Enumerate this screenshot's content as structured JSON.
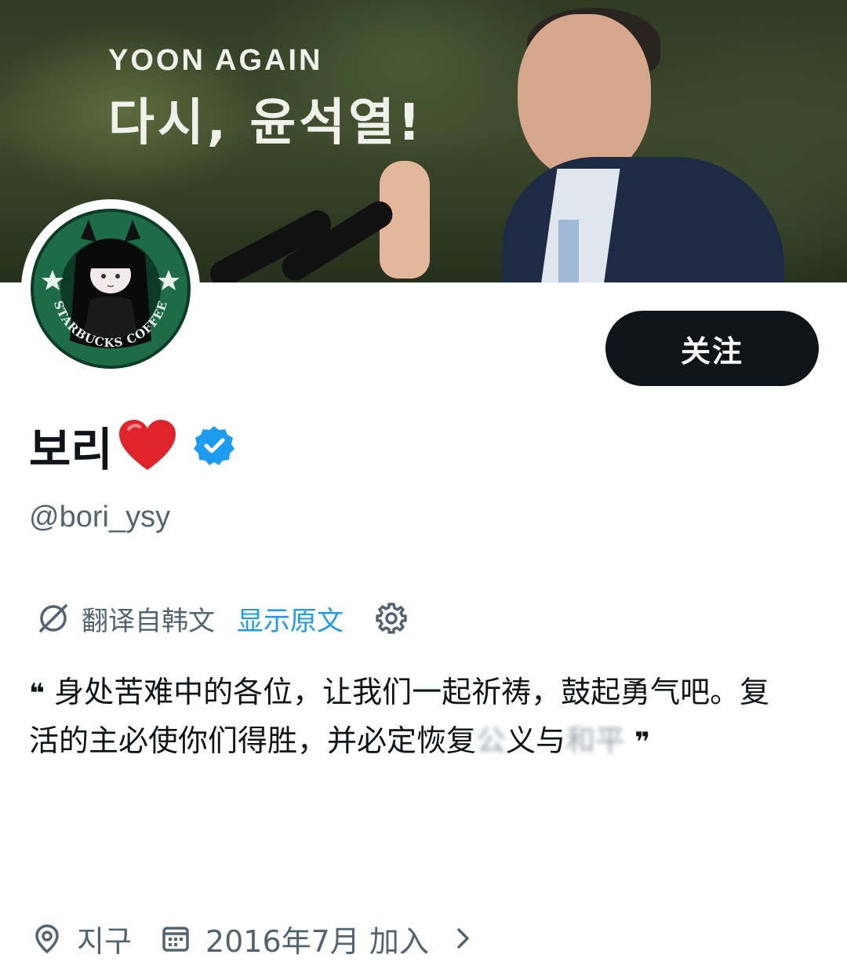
{
  "banner": {
    "headline_en": "YOON AGAIN",
    "headline_ko": "다시, 윤석열!"
  },
  "avatar": {
    "ring_text": "STARBUCKS COFFEE",
    "ring_color": "#1e6b48"
  },
  "follow_button": {
    "label": "关注"
  },
  "profile": {
    "display_name": "보리",
    "handle": "@bori_ysy",
    "verified_color": "#1d9bf0"
  },
  "translation": {
    "label": "翻译自韩文",
    "show_original": "显示原文"
  },
  "bio": {
    "open_quote": "❝",
    "text": "身处苦难中的各位，让我们一起祈祷，鼓起勇气吧。复活的主必使你们得胜，并必定恢复",
    "blurred_1": "公",
    "text_2": "义与",
    "blurred_2": "和平",
    "close_quote": "❞"
  },
  "meta": {
    "location": "지구",
    "joined": "2016年7月 加入"
  },
  "colors": {
    "text_primary": "#0f1419",
    "text_secondary": "#536471",
    "accent": "#1d9bf0"
  }
}
